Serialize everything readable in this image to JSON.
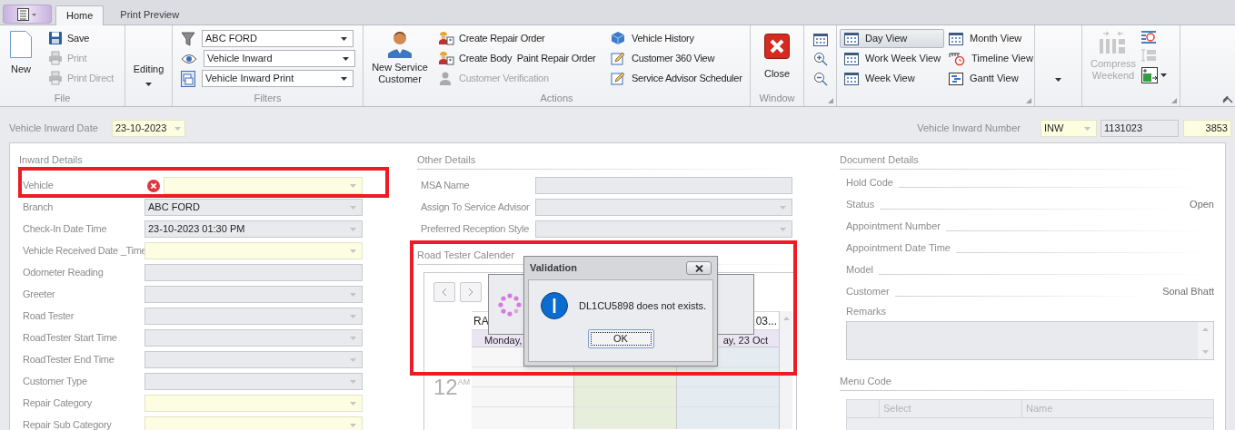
{
  "tabs": [
    {
      "label": "Home",
      "selected": true
    },
    {
      "label": "Print Preview",
      "selected": false
    }
  ],
  "ribbon": {
    "file": {
      "caption": "File",
      "new_label": "New",
      "items": [
        {
          "label": "Save",
          "disabled": false
        },
        {
          "label": "Print",
          "disabled": true
        },
        {
          "label": "Print Direct",
          "disabled": true
        }
      ]
    },
    "editing": {
      "label": "Editing"
    },
    "filters": {
      "caption": "Filters",
      "combos": [
        "ABC FORD",
        "Vehicle Inward",
        "Vehicle Inward Print"
      ]
    },
    "actions": {
      "caption": "Actions",
      "big_label": "New Service Customer",
      "items": [
        {
          "label": "Create Repair Order",
          "disabled": false
        },
        {
          "label": "Create Body  Paint Repair Order",
          "disabled": false
        },
        {
          "label": "Customer Verification",
          "disabled": true
        },
        {
          "label": "Vehicle History",
          "disabled": false
        },
        {
          "label": "Customer 360 View",
          "disabled": false
        },
        {
          "label": "Service Advisor Scheduler",
          "disabled": false
        }
      ]
    },
    "window": {
      "caption": "Window",
      "close_label": "Close"
    },
    "views": {
      "items": [
        {
          "label": "Day View",
          "selected": true
        },
        {
          "label": "Work Week View",
          "selected": false
        },
        {
          "label": "Week View",
          "selected": false
        },
        {
          "label": "Month View",
          "selected": false
        },
        {
          "label": "Timeline View",
          "selected": false
        },
        {
          "label": "Gantt View",
          "selected": false
        }
      ]
    },
    "compress": {
      "label": "Compress Weekend",
      "disabled": true
    }
  },
  "inward_date": {
    "label": "Vehicle Inward Date",
    "value": "23-10-2023"
  },
  "inward_number": {
    "label": "Vehicle Inward Number",
    "prefix": "INW",
    "code": "1131023",
    "number": "3853"
  },
  "inward_details": {
    "title": "Inward Details",
    "fields": [
      {
        "label": "Vehicle",
        "kind": "combo",
        "disabled": false,
        "error": true
      },
      {
        "label": "Branch",
        "kind": "combo",
        "disabled": true,
        "error": false,
        "value": "ABC FORD"
      },
      {
        "label": "Check-In Date Time",
        "kind": "combo",
        "disabled": true,
        "error": false,
        "value": "23-10-2023 01:30 PM"
      },
      {
        "label": "Vehicle Received Date _Time",
        "kind": "combo",
        "disabled": false,
        "error": false
      },
      {
        "label": "Odometer Reading",
        "kind": "text",
        "disabled": true,
        "error": false
      },
      {
        "label": "Greeter",
        "kind": "combo",
        "disabled": true,
        "error": false
      },
      {
        "label": "Road Tester",
        "kind": "combo",
        "disabled": true,
        "error": false
      },
      {
        "label": "RoadTester Start Time",
        "kind": "combo",
        "disabled": true,
        "error": false
      },
      {
        "label": "RoadTester End Time",
        "kind": "combo",
        "disabled": true,
        "error": false
      },
      {
        "label": "Customer Type",
        "kind": "combo",
        "disabled": true,
        "error": false
      },
      {
        "label": "Repair Category",
        "kind": "combo",
        "disabled": false,
        "error": false
      },
      {
        "label": "Repair Sub Category",
        "kind": "combo",
        "disabled": false,
        "error": false
      }
    ]
  },
  "other_details": {
    "title": "Other Details",
    "fields": [
      {
        "label": "MSA Name",
        "kind": "text",
        "disabled": true
      },
      {
        "label": "Assign To Service Advisor",
        "kind": "combo",
        "disabled": true
      },
      {
        "label": "Preferred Reception Style",
        "kind": "combo",
        "disabled": true
      }
    ]
  },
  "calendar": {
    "title": "Road Tester Calender",
    "columns": [
      {
        "header": "RA",
        "date": "Monday,",
        "color": "#f7f7f7"
      },
      {
        "color": "#e7efdc"
      },
      {
        "header": "03...",
        "date": "ay, 23 Oct",
        "color": "#e4ecf1"
      }
    ],
    "hour": "12",
    "suffix": "AM"
  },
  "document_details": {
    "title": "Document Details",
    "rows": [
      {
        "label": "Hold Code"
      },
      {
        "label": "Status",
        "value": "Open"
      },
      {
        "label": "Appointment Number"
      },
      {
        "label": "Appointment Date Time"
      },
      {
        "label": "Model"
      },
      {
        "label": "Customer",
        "value": "Sonal Bhatt"
      }
    ],
    "remarks_label": "Remarks"
  },
  "menu_code": {
    "title": "Menu Code",
    "columns": [
      "Select",
      "Name"
    ]
  },
  "dialog": {
    "title": "Validation",
    "message": "DL1CU5898 does not exists.",
    "button": "OK"
  }
}
